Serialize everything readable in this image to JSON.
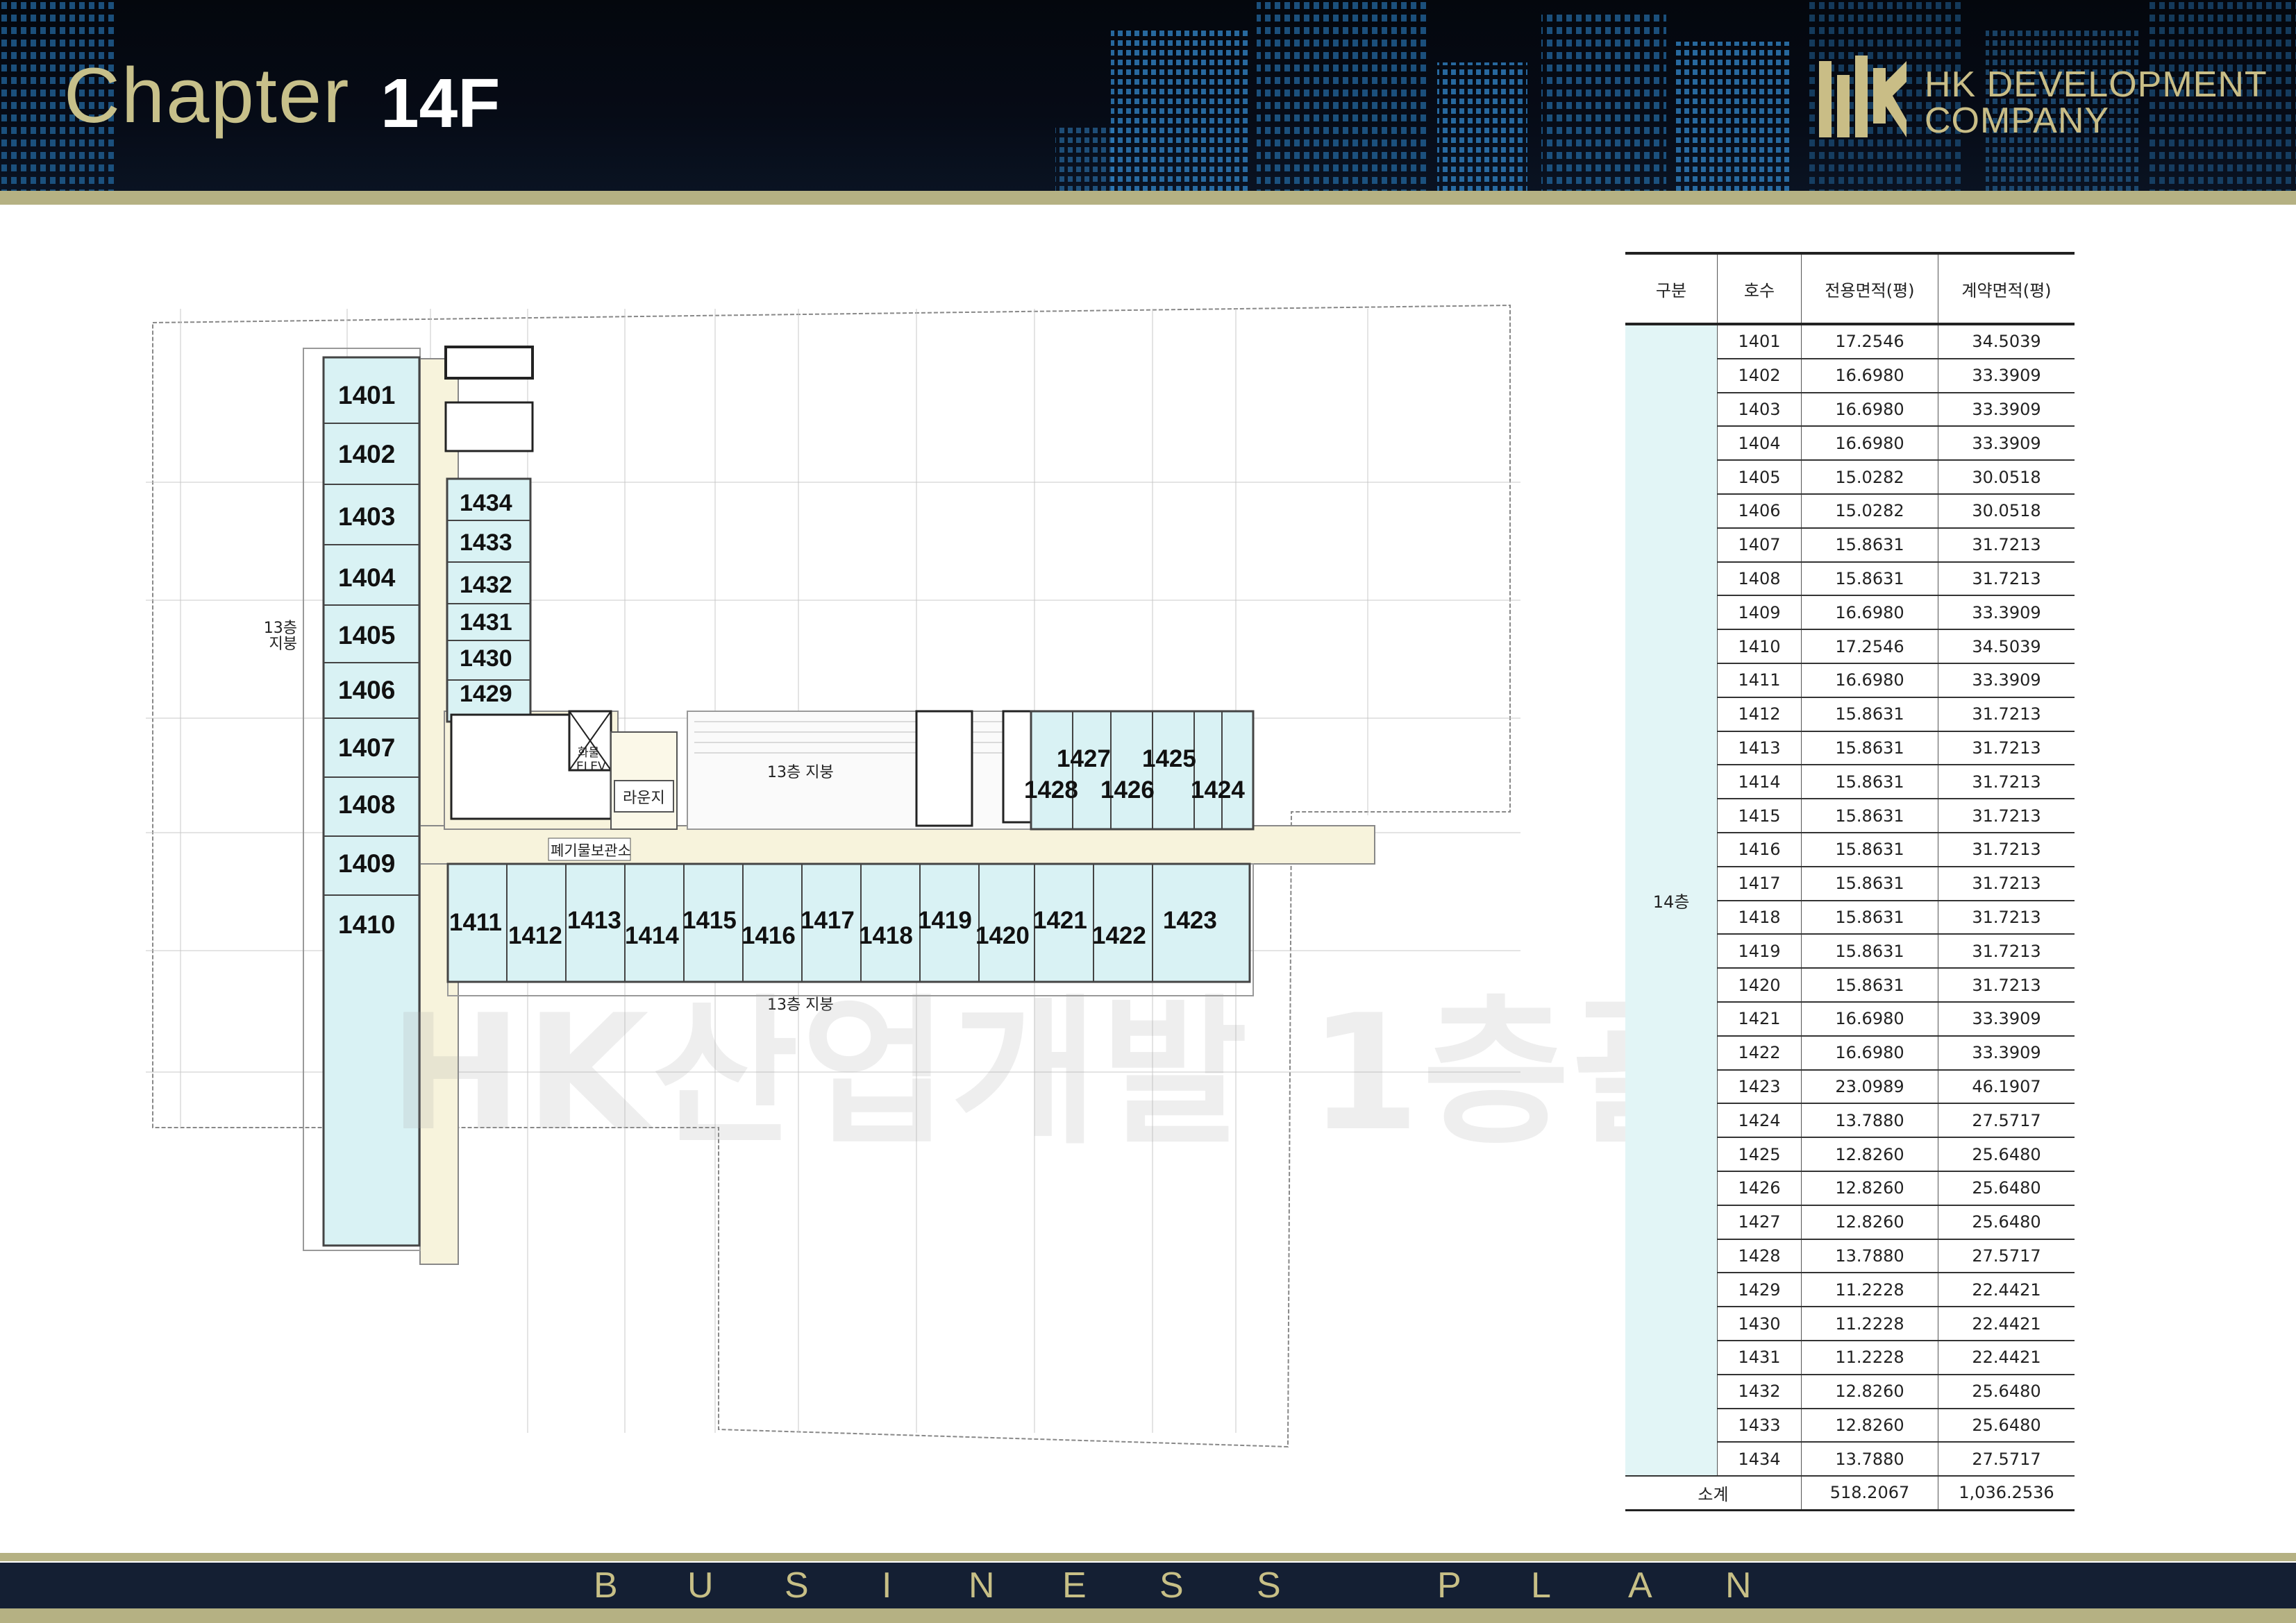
{
  "header": {
    "chapter_label": "Chapter",
    "floor_label": "14F",
    "company_line1": "HK DEVELOPMENT",
    "company_line2": "COMPANY",
    "logo_icon": "hk-logo-icon"
  },
  "footer": {
    "letters": [
      "B",
      "U",
      "S",
      "I",
      "N",
      "E",
      "S",
      "S",
      "P",
      "L",
      "A",
      "N"
    ]
  },
  "plan": {
    "roof_label": "13층 지붕",
    "roof_label_left": [
      "13층",
      "지붕"
    ],
    "lounge": "라운지",
    "waste_room": "폐기물보관소",
    "elevator": [
      "화물",
      "ELEV"
    ],
    "watermark": "HK산업개발 1층괄",
    "units_left": [
      "1401",
      "1402",
      "1403",
      "1404",
      "1405",
      "1406",
      "1407",
      "1408",
      "1409",
      "1410"
    ],
    "units_mid": [
      "1434",
      "1433",
      "1432",
      "1431",
      "1430",
      "1429"
    ],
    "units_bottom": [
      "1411",
      "1412",
      "1413",
      "1414",
      "1415",
      "1416",
      "1417",
      "1418",
      "1419",
      "1420",
      "1421",
      "1422",
      "1423"
    ],
    "units_right_top": [
      "1427",
      "1425"
    ],
    "units_right_bottom": [
      "1428",
      "1426",
      "1424"
    ]
  },
  "table": {
    "headers": [
      "구분",
      "호수",
      "전용면적(평)",
      "계약면적(평)"
    ],
    "floor": "14층",
    "rows": [
      [
        "1401",
        "17.2546",
        "34.5039"
      ],
      [
        "1402",
        "16.6980",
        "33.3909"
      ],
      [
        "1403",
        "16.6980",
        "33.3909"
      ],
      [
        "1404",
        "16.6980",
        "33.3909"
      ],
      [
        "1405",
        "15.0282",
        "30.0518"
      ],
      [
        "1406",
        "15.0282",
        "30.0518"
      ],
      [
        "1407",
        "15.8631",
        "31.7213"
      ],
      [
        "1408",
        "15.8631",
        "31.7213"
      ],
      [
        "1409",
        "16.6980",
        "33.3909"
      ],
      [
        "1410",
        "17.2546",
        "34.5039"
      ],
      [
        "1411",
        "16.6980",
        "33.3909"
      ],
      [
        "1412",
        "15.8631",
        "31.7213"
      ],
      [
        "1413",
        "15.8631",
        "31.7213"
      ],
      [
        "1414",
        "15.8631",
        "31.7213"
      ],
      [
        "1415",
        "15.8631",
        "31.7213"
      ],
      [
        "1416",
        "15.8631",
        "31.7213"
      ],
      [
        "1417",
        "15.8631",
        "31.7213"
      ],
      [
        "1418",
        "15.8631",
        "31.7213"
      ],
      [
        "1419",
        "15.8631",
        "31.7213"
      ],
      [
        "1420",
        "15.8631",
        "31.7213"
      ],
      [
        "1421",
        "16.6980",
        "33.3909"
      ],
      [
        "1422",
        "16.6980",
        "33.3909"
      ],
      [
        "1423",
        "23.0989",
        "46.1907"
      ],
      [
        "1424",
        "13.7880",
        "27.5717"
      ],
      [
        "1425",
        "12.8260",
        "25.6480"
      ],
      [
        "1426",
        "12.8260",
        "25.6480"
      ],
      [
        "1427",
        "12.8260",
        "25.6480"
      ],
      [
        "1428",
        "13.7880",
        "27.5717"
      ],
      [
        "1429",
        "11.2228",
        "22.4421"
      ],
      [
        "1430",
        "11.2228",
        "22.4421"
      ],
      [
        "1431",
        "11.2228",
        "22.4421"
      ],
      [
        "1432",
        "12.8260",
        "25.6480"
      ],
      [
        "1433",
        "12.8260",
        "25.6480"
      ],
      [
        "1434",
        "13.7880",
        "27.5717"
      ]
    ],
    "total_label": "소계",
    "total_exclusive": "518.2067",
    "total_contract": "1,036.2536"
  }
}
